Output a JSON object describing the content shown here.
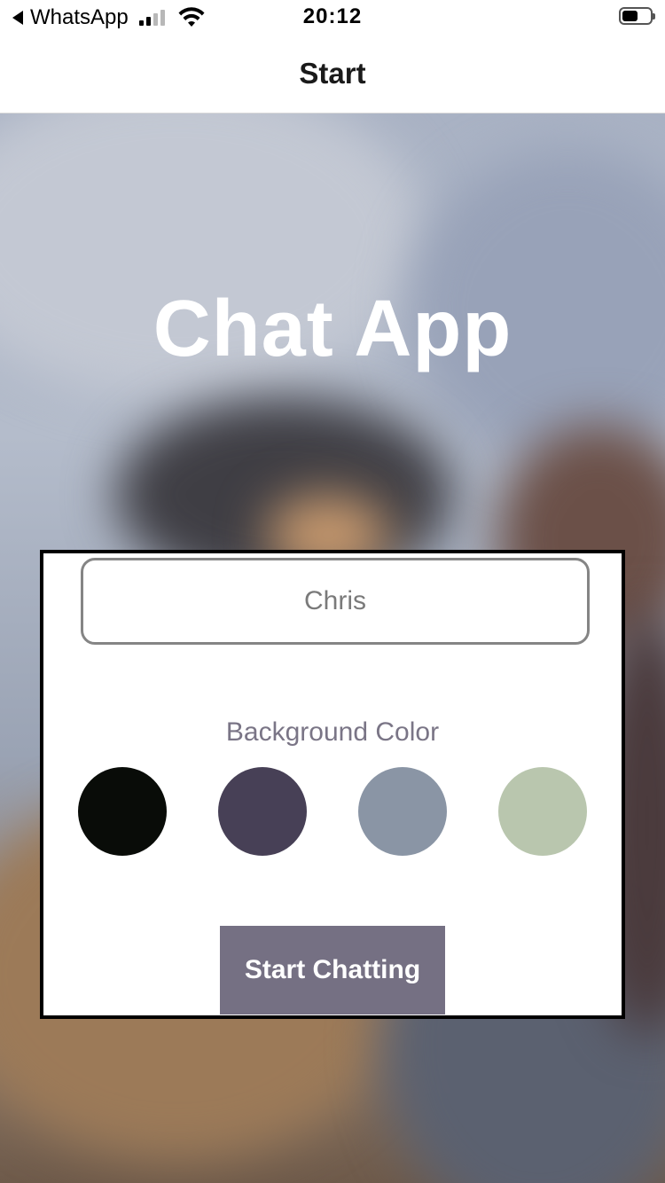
{
  "status_bar": {
    "back_app": "WhatsApp",
    "time": "20:12",
    "battery_level": 0.55,
    "signal_bars": {
      "total": 4,
      "active": 2
    }
  },
  "nav": {
    "title": "Start"
  },
  "main": {
    "app_title": "Chat App",
    "name_input": {
      "value": "Chris",
      "placeholder": "Chris"
    },
    "background_color_label": "Background Color",
    "swatches": [
      {
        "name": "black",
        "color": "#090C08"
      },
      {
        "name": "purple-gray",
        "color": "#474056"
      },
      {
        "name": "blue-gray",
        "color": "#8A95A5"
      },
      {
        "name": "sage-green",
        "color": "#B9C6AE"
      }
    ],
    "start_button_label": "Start Chatting",
    "start_button_color": "#757083"
  }
}
